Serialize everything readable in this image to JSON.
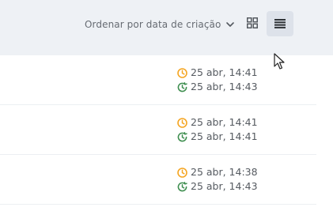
{
  "toolbar": {
    "sort_label": "Ordenar por data de criação",
    "sort_icon": "chevron-down-icon",
    "view_grid_icon": "grid-view-icon",
    "view_list_icon": "list-view-icon",
    "active_view": "list"
  },
  "colors": {
    "created_icon": "#f5a623",
    "updated_icon": "#3e8e4f",
    "toolbar_bg": "#eef1f5",
    "active_button_bg": "#dde2ea"
  },
  "rows": [
    {
      "created": "25 abr, 14:41",
      "updated": "25 abr, 14:43"
    },
    {
      "created": "25 abr, 14:41",
      "updated": "25 abr, 14:41"
    },
    {
      "created": "25 abr, 14:38",
      "updated": "25 abr, 14:43"
    }
  ]
}
